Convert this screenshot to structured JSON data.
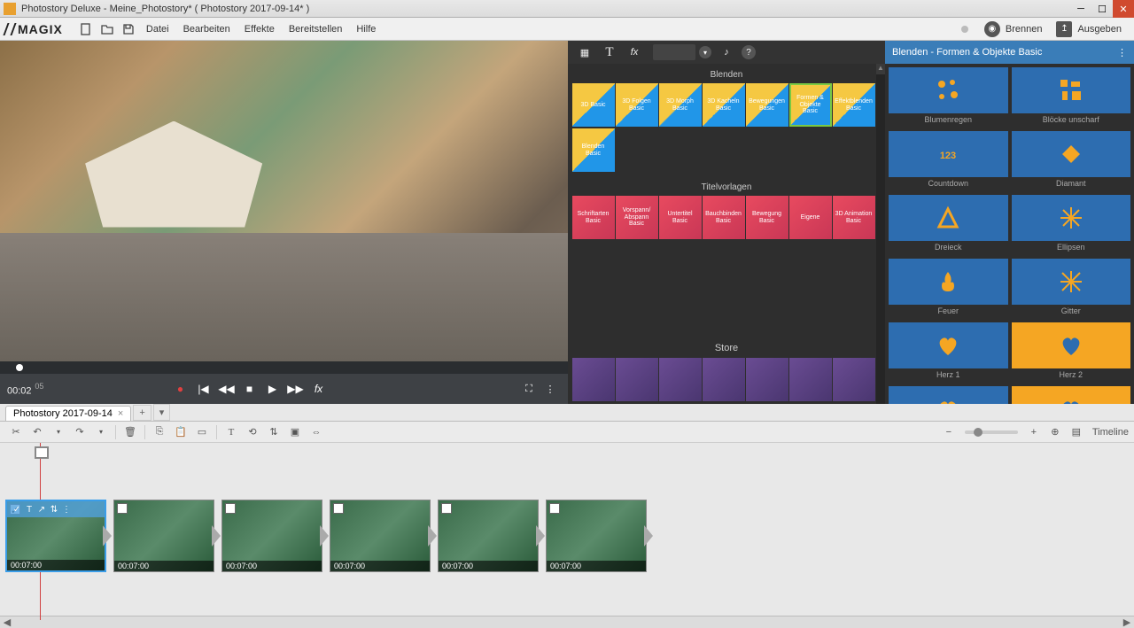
{
  "window_title": "Photostory Deluxe - Meine_Photostory* ( Photostory 2017-09-14* )",
  "brand": "MAGIX",
  "menu": {
    "file": "Datei",
    "edit": "Bearbeiten",
    "effects": "Effekte",
    "provide": "Bereitstellen",
    "help": "Hilfe"
  },
  "top_actions": {
    "burn": "Brennen",
    "export": "Ausgeben"
  },
  "timecode": "00:02",
  "timecode_frames": "05",
  "tab_name": "Photostory 2017-09-14",
  "timeline_label": "Timeline",
  "sections": {
    "blenden": "Blenden",
    "titelvorlagen": "Titelvorlagen",
    "store": "Store"
  },
  "blenden_items": [
    {
      "label": "3D Basic",
      "sel": false
    },
    {
      "label": "3D Folgen Basic",
      "sel": false
    },
    {
      "label": "3D Morph Basic",
      "sel": false
    },
    {
      "label": "3D Kacheln Basic",
      "sel": false
    },
    {
      "label": "Bewegungen Basic",
      "sel": false
    },
    {
      "label": "Formen & Objekte Basic",
      "sel": true
    },
    {
      "label": "Effektblenden Basic",
      "sel": false
    },
    {
      "label": "Blenden Basic",
      "sel": false
    }
  ],
  "titel_items": [
    {
      "label": "Schriftarten Basic"
    },
    {
      "label": "Vorspann/ Abspann Basic"
    },
    {
      "label": "Untertitel Basic"
    },
    {
      "label": "Bauchbinden Basic"
    },
    {
      "label": "Bewegung Basic"
    },
    {
      "label": "Eigene"
    },
    {
      "label": "3D Animation Basic"
    }
  ],
  "store_count": 7,
  "right_panel": {
    "title": "Blenden - Formen & Objekte Basic",
    "items": [
      {
        "name": "Blumenregen",
        "shape": "flowers"
      },
      {
        "name": "Blöcke unscharf",
        "shape": "blocks"
      },
      {
        "name": "Countdown",
        "shape": "123"
      },
      {
        "name": "Diamant",
        "shape": "diamond"
      },
      {
        "name": "Dreieck",
        "shape": "triangle"
      },
      {
        "name": "Ellipsen",
        "shape": "star"
      },
      {
        "name": "Feuer",
        "shape": "fire"
      },
      {
        "name": "Gitter",
        "shape": "grid"
      },
      {
        "name": "Herz 1",
        "shape": "heart"
      },
      {
        "name": "Herz 2",
        "shape": "heart2"
      },
      {
        "name": "",
        "shape": "heart"
      },
      {
        "name": "",
        "shape": "heart2"
      }
    ]
  },
  "clips": [
    {
      "duration": "00:07:00",
      "selected": true
    },
    {
      "duration": "00:07:00",
      "selected": false
    },
    {
      "duration": "00:07:00",
      "selected": false
    },
    {
      "duration": "00:07:00",
      "selected": false
    },
    {
      "duration": "00:07:00",
      "selected": false
    },
    {
      "duration": "00:07:00",
      "selected": false
    }
  ]
}
